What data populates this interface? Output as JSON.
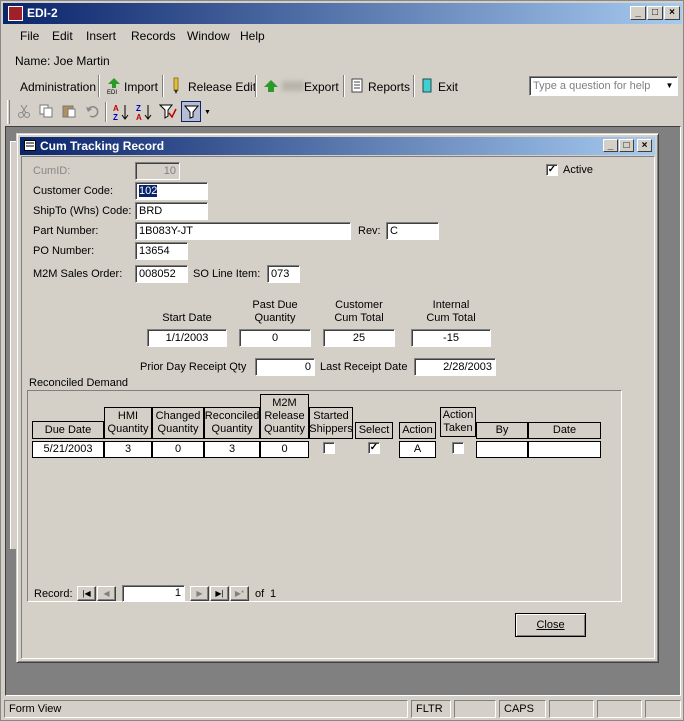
{
  "app": {
    "title": "EDI-2"
  },
  "menu": {
    "file": "File",
    "edit": "Edit",
    "insert": "Insert",
    "records": "Records",
    "window": "Window",
    "help": "Help"
  },
  "user": {
    "name_label": "Name: Joe Martin"
  },
  "toolbar": {
    "administration": "Administration",
    "import": "Import",
    "release_edit": "Release Edit",
    "export": "Export",
    "reports": "Reports",
    "exit": "Exit",
    "help_placeholder": "Type a question for help"
  },
  "form": {
    "title": "Cum Tracking Record",
    "cumid_label": "CumID:",
    "cumid_value": "10",
    "active_label": "Active",
    "active_checked": true,
    "customer_code_label": "Customer Code:",
    "customer_code_value": "102",
    "shipto_label": "ShipTo (Whs) Code:",
    "shipto_value": "BRD",
    "part_number_label": "Part Number:",
    "part_number_value": "1B083Y-JT",
    "rev_label": "Rev:",
    "rev_value": "C",
    "po_label": "PO Number:",
    "po_value": "13654",
    "m2m_so_label": "M2M Sales Order:",
    "m2m_so_value": "008052",
    "so_line_label": "SO Line Item:",
    "so_line_value": "073",
    "start_date_label": "Start Date",
    "start_date_value": "1/1/2003",
    "past_due_label_1": "Past Due",
    "past_due_label_2": "Quantity",
    "past_due_value": "0",
    "customer_cum_label_1": "Customer",
    "customer_cum_label_2": "Cum Total",
    "customer_cum_value": "25",
    "internal_cum_label_1": "Internal",
    "internal_cum_label_2": "Cum Total",
    "internal_cum_value": "-15",
    "prior_day_label": "Prior Day Receipt Qty",
    "prior_day_value": "0",
    "last_receipt_label": "Last Receipt Date",
    "last_receipt_value": "2/28/2003",
    "reconciled_label": "Reconciled Demand"
  },
  "subform": {
    "headers": {
      "due_date": "Due Date",
      "hmi_1": "HMI",
      "hmi_2": "Quantity",
      "changed_1": "Changed",
      "changed_2": "Quantity",
      "reconciled_1": "Reconciled",
      "reconciled_2": "Quantity",
      "m2m_1": "M2M",
      "m2m_2": "Release",
      "m2m_3": "Quantity",
      "started_1": "Started",
      "started_2": "Shippers",
      "select": "Select",
      "action": "Action",
      "action_taken_1": "Action",
      "action_taken_2": "Taken",
      "by": "By",
      "date": "Date"
    },
    "row": {
      "due_date": "5/21/2003",
      "hmi": "3",
      "changed": "0",
      "reconciled": "3",
      "m2m": "0",
      "started": false,
      "select": true,
      "action": "A",
      "action_taken": false,
      "by": "",
      "date": ""
    },
    "nav": {
      "record_label": "Record:",
      "current": "1",
      "of_label": "of",
      "total": "1"
    }
  },
  "close_button": "Close",
  "status": {
    "view": "Form View",
    "fltr": "FLTR",
    "caps": "CAPS"
  }
}
